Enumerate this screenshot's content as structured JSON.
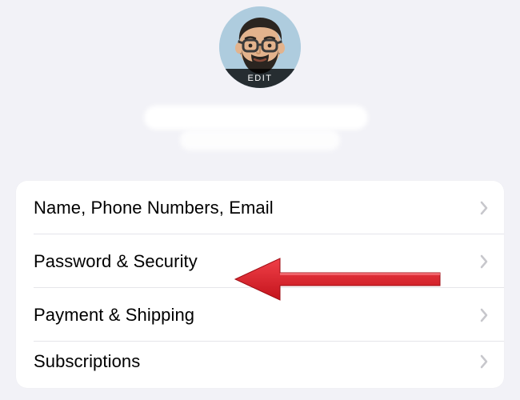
{
  "header": {
    "avatar_edit_label": "EDIT"
  },
  "settings": {
    "items": [
      {
        "label": "Name, Phone Numbers, Email"
      },
      {
        "label": "Password & Security"
      },
      {
        "label": "Payment & Shipping"
      },
      {
        "label": "Subscriptions"
      }
    ]
  },
  "annotation": {
    "arrow_color": "#e8202a",
    "target_index": 1
  }
}
